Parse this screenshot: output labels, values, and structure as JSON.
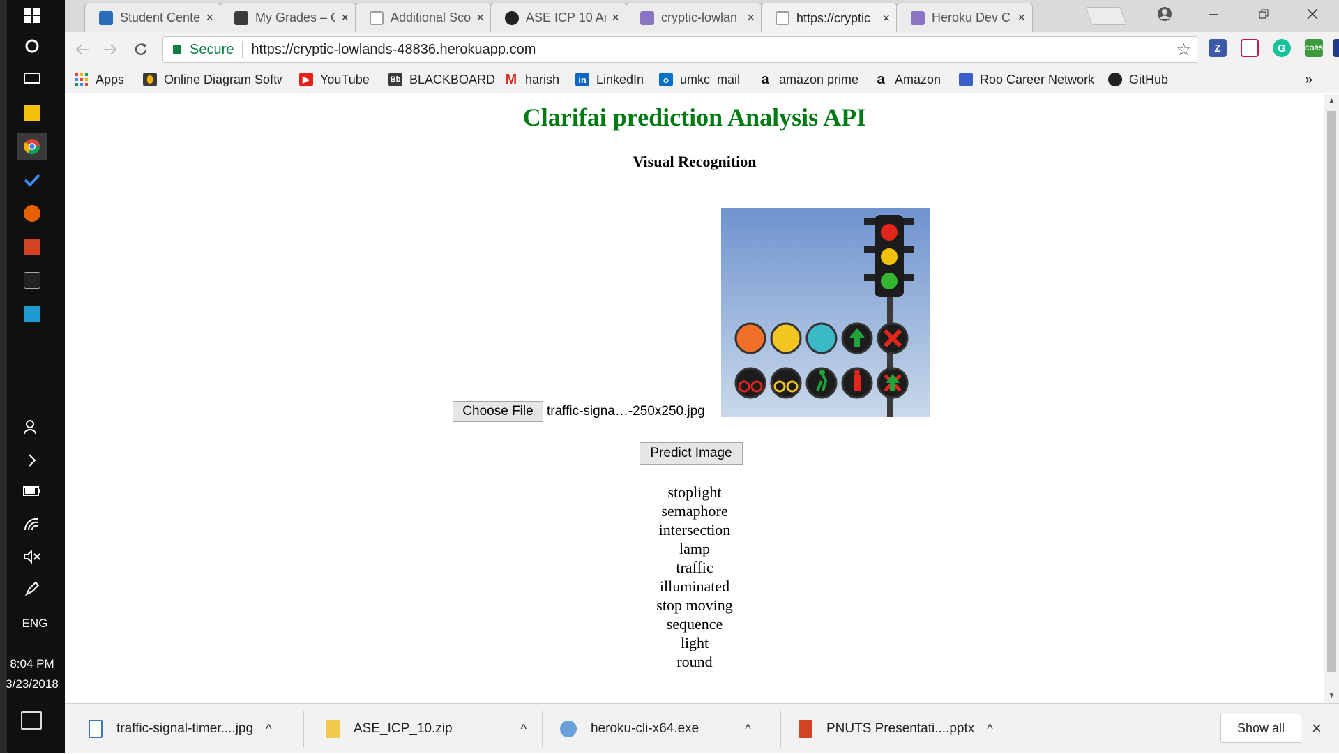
{
  "taskbar": {
    "language": "ENG",
    "time": "8:04 PM",
    "date": "3/23/2018"
  },
  "browser": {
    "tabs": [
      {
        "label": "Student Cente",
        "icon": "student-center-icon",
        "color": "#2a6ebb"
      },
      {
        "label": "My Grades – C",
        "icon": "blackboard-icon",
        "color": "#3b3b3b"
      },
      {
        "label": "Additional Sco",
        "icon": "page-icon",
        "color": "#9e9e9e"
      },
      {
        "label": "ASE ICP 10 Ar",
        "icon": "github-icon",
        "color": "#222222"
      },
      {
        "label": "cryptic-lowlan",
        "icon": "heroku-icon",
        "color": "#8a74c4"
      },
      {
        "label": "https://cryptic",
        "icon": "page-icon",
        "color": "#9e9e9e"
      },
      {
        "label": "Heroku Dev C",
        "icon": "heroku-icon",
        "color": "#8a74c4"
      }
    ],
    "close_glyph": "×",
    "address": {
      "secure_label": "Secure",
      "url": "https://cryptic-lowlands-48836.herokuapp.com"
    },
    "bookmarks": [
      {
        "label": "Apps",
        "icon": "apps-grid-icon",
        "color": "#e8453c"
      },
      {
        "label": "Online Diagram Softw",
        "icon": "bulb-icon",
        "color": "#f4b400"
      },
      {
        "label": "YouTube",
        "icon": "youtube-icon",
        "color": "#e62117"
      },
      {
        "label": "BLACKBOARD",
        "icon": "blackboard-icon",
        "color": "#3b3b3b"
      },
      {
        "label": "harish",
        "icon": "gmail-icon",
        "color": "#d93025"
      },
      {
        "label": "LinkedIn",
        "icon": "linkedin-icon",
        "color": "#0a66c2"
      },
      {
        "label": "umkc  mail",
        "icon": "outlook-icon",
        "color": "#0072c6"
      },
      {
        "label": "amazon prime",
        "icon": "amazon-icon",
        "color": "#111111"
      },
      {
        "label": "Amazon",
        "icon": "amazon-icon",
        "color": "#111111"
      },
      {
        "label": "Roo Career Network",
        "icon": "roo-icon",
        "color": "#3a5fcd"
      },
      {
        "label": "GitHub",
        "icon": "github-icon",
        "color": "#222222"
      }
    ],
    "bookmarks_overflow": "»"
  },
  "page": {
    "title": "Clarifai prediction Analysis API",
    "subtitle": "Visual Recognition",
    "choose_file_label": "Choose File",
    "file_name": "traffic-signa…-250x250.jpg",
    "predict_label": "Predict Image",
    "predictions": [
      "stoplight",
      "semaphore",
      "intersection",
      "lamp",
      "traffic",
      "illuminated",
      "stop moving",
      "sequence",
      "light",
      "round"
    ],
    "title_color": "#007a12"
  },
  "downloads": {
    "items": [
      {
        "label": "traffic-signal-timer....jpg",
        "icon": "image-file-icon",
        "color": "#3a76c4"
      },
      {
        "label": "ASE_ICP_10.zip",
        "icon": "zip-file-icon",
        "color": "#f2c94c"
      },
      {
        "label": "heroku-cli-x64.exe",
        "icon": "exe-file-icon",
        "color": "#6aa0d8"
      },
      {
        "label": "PNUTS Presentati....pptx",
        "icon": "pptx-file-icon",
        "color": "#d04423"
      }
    ],
    "chevron": "^",
    "show_all_label": "Show all",
    "close_glyph": "×"
  }
}
